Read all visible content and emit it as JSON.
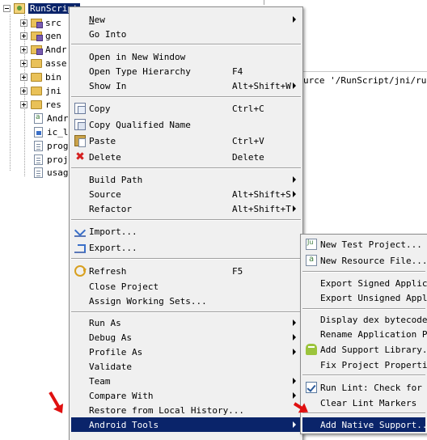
{
  "tree": {
    "root": "RunScript",
    "items": [
      {
        "label": "src",
        "icon": "package-folder-icon",
        "expandable": true
      },
      {
        "label": "gen",
        "icon": "package-folder-icon",
        "expandable": true
      },
      {
        "label": "Andr",
        "icon": "library-icon",
        "expandable": true
      },
      {
        "label": "asse",
        "icon": "folder-icon",
        "expandable": true
      },
      {
        "label": "bin",
        "icon": "folder-icon",
        "expandable": true
      },
      {
        "label": "jni",
        "icon": "folder-icon",
        "expandable": true
      },
      {
        "label": "res",
        "icon": "folder-icon",
        "expandable": true
      },
      {
        "label": "Andr",
        "icon": "xml-file-icon",
        "expandable": false
      },
      {
        "label": "ic_l",
        "icon": "image-file-icon",
        "expandable": false
      },
      {
        "label": "prog",
        "icon": "file-icon",
        "expandable": false
      },
      {
        "label": "proj",
        "icon": "file-icon",
        "expandable": false
      },
      {
        "label": "usag",
        "icon": "file-icon",
        "expandable": false
      }
    ]
  },
  "console": {
    "text": "urce '/RunScript/jni/runsc"
  },
  "context_menu": {
    "items": {
      "new": {
        "label": "New"
      },
      "go_into": {
        "label": "Go Into"
      },
      "open_new_window": {
        "label": "Open in New Window"
      },
      "open_type_hierarchy": {
        "label": "Open Type Hierarchy",
        "shortcut": "F4"
      },
      "show_in": {
        "label": "Show In",
        "shortcut": "Alt+Shift+W"
      },
      "copy": {
        "label": "Copy",
        "shortcut": "Ctrl+C"
      },
      "copy_qualified": {
        "label": "Copy Qualified Name"
      },
      "paste": {
        "label": "Paste",
        "shortcut": "Ctrl+V"
      },
      "delete": {
        "label": "Delete",
        "shortcut": "Delete"
      },
      "build_path": {
        "label": "Build Path"
      },
      "source": {
        "label": "Source",
        "shortcut": "Alt+Shift+S"
      },
      "refactor": {
        "label": "Refactor",
        "shortcut": "Alt+Shift+T"
      },
      "import": {
        "label": "Import..."
      },
      "export": {
        "label": "Export..."
      },
      "refresh": {
        "label": "Refresh",
        "shortcut": "F5"
      },
      "close_project": {
        "label": "Close Project"
      },
      "assign_working_sets": {
        "label": "Assign Working Sets..."
      },
      "run_as": {
        "label": "Run As"
      },
      "debug_as": {
        "label": "Debug As"
      },
      "profile_as": {
        "label": "Profile As"
      },
      "validate": {
        "label": "Validate"
      },
      "team": {
        "label": "Team"
      },
      "compare_with": {
        "label": "Compare With"
      },
      "restore_local_history": {
        "label": "Restore from Local History..."
      },
      "android_tools": {
        "label": "Android Tools"
      }
    }
  },
  "android_tools_menu": {
    "items": {
      "new_test_project": {
        "label": "New Test Project..."
      },
      "new_resource_file": {
        "label": "New Resource File..."
      },
      "export_signed": {
        "label": "Export Signed Applicati"
      },
      "export_unsigned": {
        "label": "Export Unsigned Applica"
      },
      "display_dex": {
        "label": "Display dex bytecode"
      },
      "rename_package": {
        "label": "Rename Application Pack"
      },
      "add_support_library": {
        "label": "Add Support Library..."
      },
      "fix_project_properties": {
        "label": "Fix Project Properties"
      },
      "run_lint": {
        "label": "Run Lint: Check for Co"
      },
      "clear_lint": {
        "label": "Clear Lint Markers"
      },
      "add_native_support": {
        "label": "Add Native Support..."
      }
    }
  },
  "colors": {
    "selection": "#0a246a",
    "menu_bg": "#f0f0f0",
    "annotation_arrow": "#e01010"
  }
}
